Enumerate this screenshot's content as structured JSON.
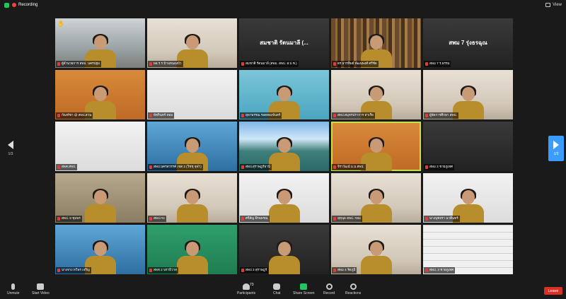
{
  "topbar": {
    "recording_label": "Recording",
    "view_label": "View"
  },
  "pager": {
    "left": "1/3",
    "right": "1/3"
  },
  "tiles": [
    {
      "name": "ผู้อำนวยการ สพป. นครปฐม",
      "hand": "✋",
      "bg": "bg-office",
      "person": true
    },
    {
      "name": "ผอ.ร.ร.บ้านหนองบัว",
      "bg": "bg-room",
      "person": true
    },
    {
      "name": "สมชาติ รัตนมาลี (สพม. สพป. ส.ป.ช.)",
      "center": "สมชาติ รัตนมาลี (...",
      "bg": "bg-dark"
    },
    {
      "name": "ดร.ธารทิพย์ พัฒนพงศ์ ศรีชัย",
      "bg": "bg-books",
      "person": true
    },
    {
      "name": "สพม 7 ร.ธรรม",
      "center": "สพม 7 รุ่งธรฉุณ",
      "bg": "bg-dark"
    },
    {
      "name": "กัณฑ์ชา @ สพป.สวน",
      "bg": "bg-orange",
      "person": true
    },
    {
      "name": "พัชรินทร์ ทอม",
      "bg": "bg-white"
    },
    {
      "name": "ยุพาพรรณ รอดทองจันทร์",
      "bg": "bg-cyan",
      "person": true
    },
    {
      "name": "สพป.สมุทรปราการ ท่าเรือ",
      "bg": "bg-room",
      "person": true
    },
    {
      "name": "ผู้จัดการศึกษา สพป.",
      "bg": "bg-room",
      "person": true
    },
    {
      "name": "สพค.สพป.",
      "bg": "bg-white"
    },
    {
      "name": "สพป.นครสวรรค์ เขต 2 (วิชชุ จุฬา)",
      "bg": "bg-blue",
      "person": true
    },
    {
      "name": "สพป.สุราษฎร์ธานี",
      "bg": "bg-lake",
      "person": true
    },
    {
      "name": "จิราวัฒน์ ม.ม.สพป.",
      "bg": "bg-orange",
      "person": true,
      "active": true
    },
    {
      "name": "สพม 3 ชายภูเทศ",
      "bg": "bg-dark"
    },
    {
      "name": "สพป. 8 ชุมพร",
      "bg": "bg-wall",
      "person": true
    },
    {
      "name": "สพป.กบ",
      "bg": "bg-room",
      "person": true
    },
    {
      "name": "ศรีสัญ ธีรนพรณ",
      "bg": "bg-white",
      "person": true
    },
    {
      "name": "สุทุนุธ สพป. กอม",
      "bg": "bg-room",
      "person": true
    },
    {
      "name": "นางนุชจรา นาคินทร์",
      "bg": "bg-white",
      "person": true
    },
    {
      "name": "นางจาง ทวีพร เจริญ",
      "bg": "bg-blue",
      "person": true
    },
    {
      "name": "สพท 2 นราธิวาส",
      "bg": "bg-green",
      "person": true
    },
    {
      "name": "สพป 3 สุราษฎร์",
      "bg": "bg-dark",
      "person": true
    },
    {
      "name": "สพม 4 รัตภูมิ",
      "bg": "bg-room",
      "person": true
    },
    {
      "name": "สพป. 3 ชายภูเทศ",
      "bg": "bg-brick"
    }
  ],
  "toolbar": {
    "unmute": "Unmute",
    "start_video": "Start Video",
    "participants": "Participants",
    "participants_count": "73",
    "chat": "Chat",
    "share_screen": "Share Screen",
    "record": "Record",
    "reactions": "Reactions",
    "leave": "Leave"
  }
}
